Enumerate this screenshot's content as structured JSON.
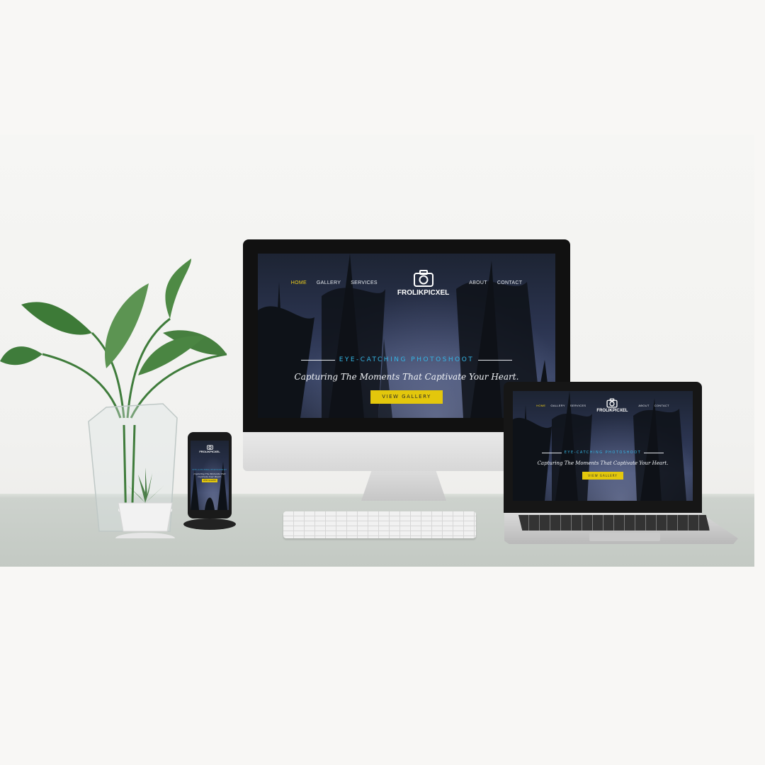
{
  "site": {
    "brand": "FROLIKPICXEL",
    "nav_left": [
      "HOME",
      "GALLERY",
      "SERVICES"
    ],
    "nav_right": [
      "ABOUT",
      "CONTACT"
    ],
    "tagline": "EYE-CATCHING PHOTOSHOOT",
    "headline": "Capturing The Moments That Captivate Your Heart.",
    "cta_label": "VIEW GALLERY"
  },
  "colors": {
    "accent_yellow": "#e3c70c",
    "accent_cyan": "#35b6e6",
    "active_nav": "#f2d21a"
  },
  "icons": {
    "logo": "camera-icon"
  }
}
